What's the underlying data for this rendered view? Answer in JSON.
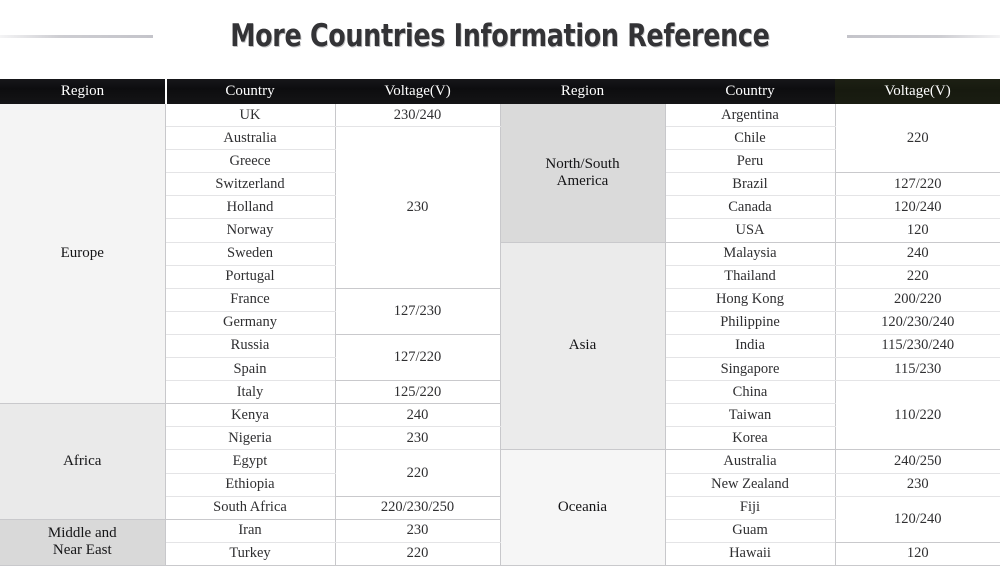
{
  "header": {
    "title": "More Countries Information Reference",
    "rule_left": "decorative-rule",
    "rule_right": "decorative-rule"
  },
  "colors": {
    "header_bg": "#111113",
    "header_bg_tinted": "#191c11",
    "header_text": "#ffffff",
    "title_text": "#333336",
    "body_text": "#2f2f31",
    "grid_line": "#c8c8cb",
    "row_line": "#e4e4e6",
    "shade_europe": "#f4f4f4",
    "shade_africa": "#eaeaea",
    "shade_middle_east": "#d9d9d9",
    "shade_americas": "#dadada",
    "shade_asia": "#ebebeb",
    "shade_oceania": "#f6f6f6"
  },
  "table": {
    "columns": {
      "region": "Region",
      "country": "Country",
      "voltage": "Voltage(V)"
    },
    "left_headers": [
      "Region",
      "Country",
      "Voltage(V)"
    ],
    "right_headers": [
      "Region",
      "Country",
      "Voltage(V)"
    ],
    "left_panel": [
      {
        "region": "Europe",
        "rows": 13,
        "countries": [
          "UK",
          "Australia",
          "Greece",
          "Switzerland",
          "Holland",
          "Norway",
          "Sweden",
          "Portugal",
          "France",
          "Germany",
          "Russia",
          "Spain",
          "Italy"
        ],
        "voltages": [
          {
            "value": "230/240",
            "span": 1
          },
          {
            "value": "230",
            "span": 7
          },
          {
            "value": "127/230",
            "span": 2
          },
          {
            "value": "127/220",
            "span": 2
          },
          {
            "value": "125/220",
            "span": 1
          }
        ]
      },
      {
        "region": "Africa",
        "rows": 5,
        "countries": [
          "Kenya",
          "Nigeria",
          "Egypt",
          "Ethiopia",
          "South Africa"
        ],
        "voltages": [
          {
            "value": "240",
            "span": 1
          },
          {
            "value": "230",
            "span": 1
          },
          {
            "value": "220",
            "span": 2
          },
          {
            "value": "220/230/250",
            "span": 1
          }
        ]
      },
      {
        "region": "Middle and Near East",
        "region_line1": "Middle and",
        "region_line2": "Near East",
        "rows": 2,
        "countries": [
          "Iran",
          "Turkey"
        ],
        "voltages": [
          {
            "value": "230",
            "span": 1
          },
          {
            "value": "220",
            "span": 1
          }
        ]
      }
    ],
    "right_panel": [
      {
        "region": "North/South America",
        "region_line1": "North/South",
        "region_line2": "America",
        "rows": 6,
        "countries": [
          "Argentina",
          "Chile",
          "Peru",
          "Brazil",
          "Canada",
          "USA"
        ],
        "voltages": [
          {
            "value": "220",
            "span": 3
          },
          {
            "value": "127/220",
            "span": 1
          },
          {
            "value": "120/240",
            "span": 1
          },
          {
            "value": "120",
            "span": 1
          }
        ]
      },
      {
        "region": "Asia",
        "rows": 9,
        "countries": [
          "Malaysia",
          "Thailand",
          "Hong Kong",
          "Philippine",
          "India",
          "Singapore",
          "China",
          "Taiwan",
          "Korea"
        ],
        "voltages": [
          {
            "value": "240",
            "span": 1
          },
          {
            "value": "220",
            "span": 1
          },
          {
            "value": "200/220",
            "span": 1
          },
          {
            "value": "120/230/240",
            "span": 1
          },
          {
            "value": "115/230/240",
            "span": 1
          },
          {
            "value": "115/230",
            "span": 1
          },
          {
            "value": "110/220",
            "span": 3
          }
        ]
      },
      {
        "region": "Oceania",
        "rows": 5,
        "countries": [
          "Australia",
          "New Zealand",
          "Fiji",
          "Guam",
          "Hawaii"
        ],
        "voltages": [
          {
            "value": "240/250",
            "span": 1
          },
          {
            "value": "230",
            "span": 1
          },
          {
            "value": "120/240",
            "span": 2
          },
          {
            "value": "120",
            "span": 1
          }
        ]
      }
    ]
  }
}
